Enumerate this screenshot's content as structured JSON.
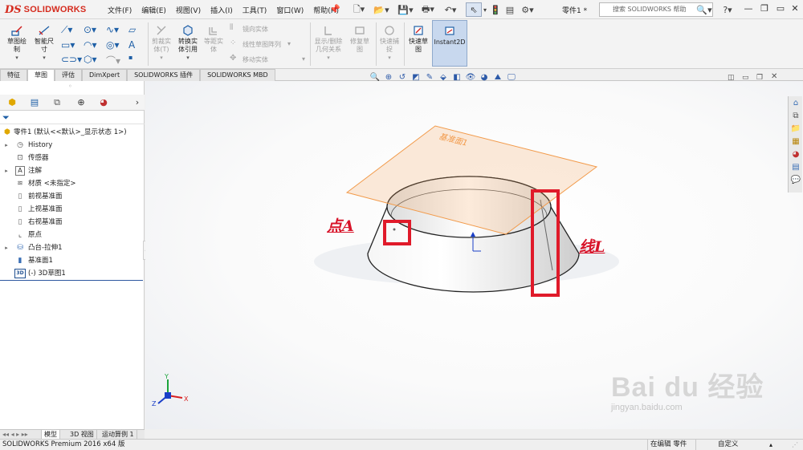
{
  "app": {
    "logo_mark": "DS",
    "logo_text": "SOLIDWORKS",
    "doc_title": "零件1 *",
    "help_search_placeholder": "搜索 SOLIDWORKS 帮助"
  },
  "menu": [
    "文件(F)",
    "编辑(E)",
    "视图(V)",
    "插入(I)",
    "工具(T)",
    "窗口(W)",
    "帮助(H)"
  ],
  "ribbon": {
    "sketch": "草图绘\n制",
    "smart_dim": "智能尺\n寸",
    "trim": "剪裁实\n体(T)",
    "convert": "转换实\n体引用",
    "offset": "等距实\n体",
    "mirror": "镜向实体",
    "linear_pattern": "线性草图阵列",
    "move": "移动实体",
    "relations": "显示/删除\n几何关系",
    "repair": "修复草\n图",
    "quick_snap": "快速捕\n捉",
    "rapid_sketch": "快速草\n图",
    "instant2d": "Instant2D"
  },
  "tabs": [
    "特征",
    "草图",
    "评估",
    "DimXpert",
    "SOLIDWORKS 插件",
    "SOLIDWORKS MBD"
  ],
  "active_tab": "草图",
  "tree": {
    "root": "零件1 (默认<<默认>_显示状态 1>)",
    "items": [
      {
        "label": "History",
        "icon": "history-icon",
        "expandable": true
      },
      {
        "label": "传感器",
        "icon": "sensor-icon",
        "expandable": false
      },
      {
        "label": "注解",
        "icon": "annotation-icon",
        "expandable": true
      },
      {
        "label": "材质 <未指定>",
        "icon": "material-icon",
        "expandable": false
      },
      {
        "label": "前视基准面",
        "icon": "plane-icon",
        "expandable": false
      },
      {
        "label": "上视基准面",
        "icon": "plane-icon",
        "expandable": false
      },
      {
        "label": "右视基准面",
        "icon": "plane-icon",
        "expandable": false
      },
      {
        "label": "原点",
        "icon": "origin-icon",
        "expandable": false
      },
      {
        "label": "凸台-拉伸1",
        "icon": "boss-extrude-icon",
        "expandable": true
      },
      {
        "label": "基准面1",
        "icon": "plane-icon",
        "expandable": false
      },
      {
        "label": "(-) 3D草图1",
        "icon": "3d-sketch-icon",
        "expandable": false
      }
    ]
  },
  "bottom_tabs": [
    "模型",
    "3D 视图",
    "运动算例 1"
  ],
  "status": {
    "product": "SOLIDWORKS Premium 2016 x64 版",
    "editing": "在编辑 零件",
    "custom": "自定义"
  },
  "viewport": {
    "plane_label": "基准面1",
    "annotation_point": "点A",
    "annotation_line": "线L",
    "triad_x": "X",
    "triad_y": "Y",
    "triad_z": "Z"
  },
  "watermark": {
    "main": "Bai  du 经验",
    "sub": "jingyan.baidu.com"
  },
  "colors": {
    "brand": "#d52b1e",
    "annotation": "#d8142a",
    "plane": "#f29a4a",
    "tree_separator": "#2d58a0"
  }
}
